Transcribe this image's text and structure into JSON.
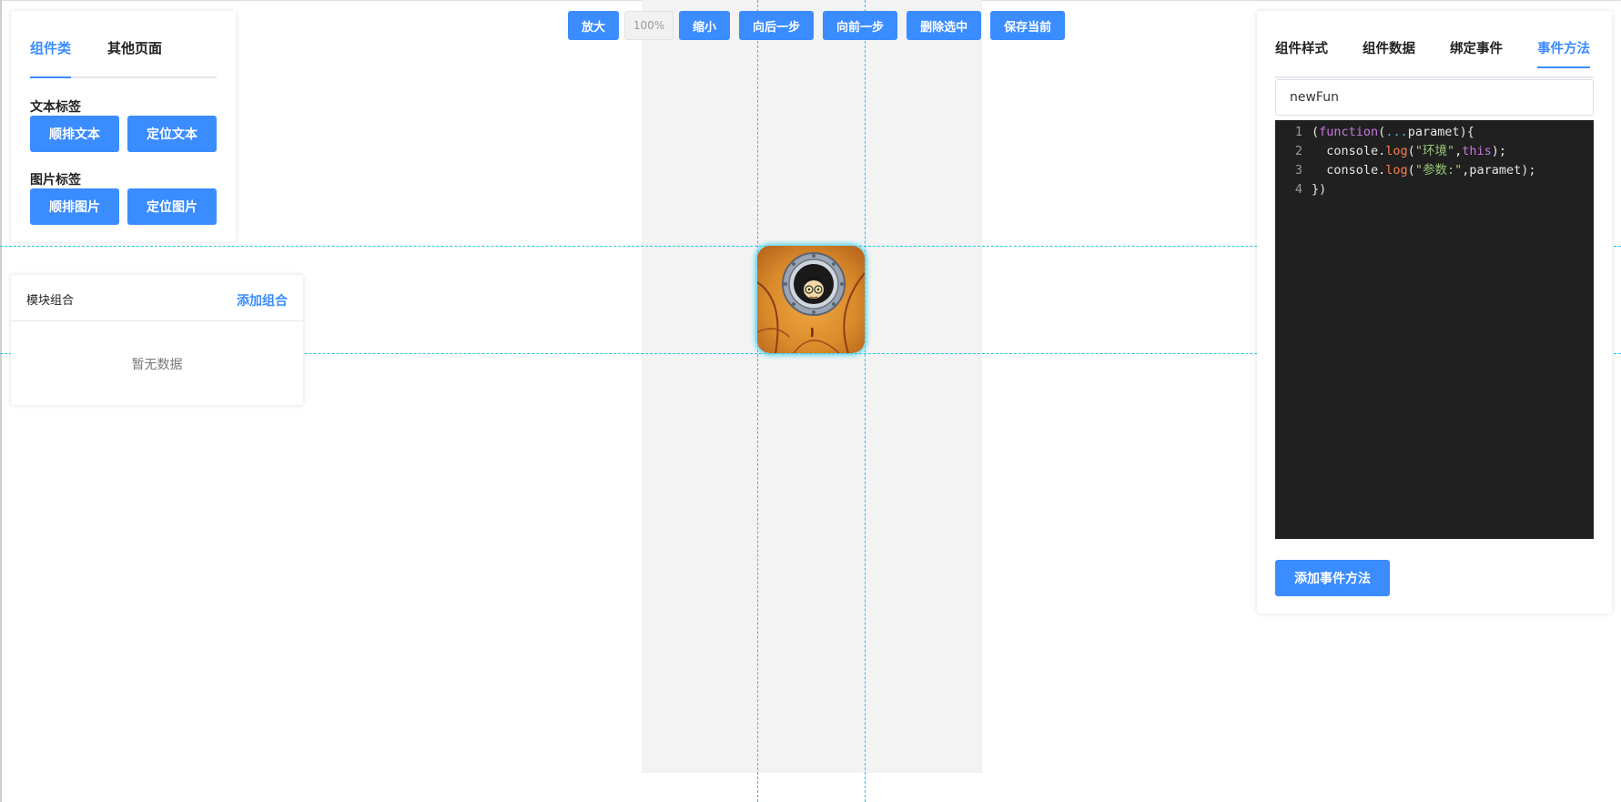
{
  "toolbar": {
    "zoom_in": "放大",
    "zoom_level": "100%",
    "zoom_out": "缩小",
    "undo": "向后一步",
    "redo": "向前一步",
    "delete_selected": "删除选中",
    "save_current": "保存当前"
  },
  "component_panel": {
    "tabs": [
      "组件类",
      "其他页面"
    ],
    "active_tab": "组件类",
    "text_section": {
      "title": "文本标签",
      "buttons": [
        "顺排文本",
        "定位文本"
      ]
    },
    "image_section": {
      "title": "图片标签",
      "buttons": [
        "顺排图片",
        "定位图片"
      ]
    }
  },
  "combo_panel": {
    "title": "模块组合",
    "add_label": "添加组合",
    "empty_text": "暂无数据"
  },
  "property_panel": {
    "tabs": [
      "组件样式",
      "组件数据",
      "绑定事件",
      "事件方法"
    ],
    "active_tab": "事件方法",
    "method_name": "newFun",
    "add_button": "添加事件方法",
    "code": {
      "line_numbers": [
        "1",
        "2",
        "3",
        "4"
      ],
      "l1": {
        "open": "(",
        "kw": "function",
        "paren": "(",
        "spread": "...",
        "rest": "paramet){"
      },
      "l2": {
        "obj": "  console.",
        "fn": "log",
        "p": "(",
        "str": "\"环境\"",
        "comma": ",",
        "kw": "this",
        "end": ");"
      },
      "l3": {
        "obj": "  console.",
        "fn": "log",
        "p": "(",
        "str": "\"参数:\"",
        "end": ",paramet);"
      },
      "l4": {
        "text": "})"
      }
    }
  },
  "canvas": {
    "selected_image": "cartoon-character-porthole-image"
  },
  "colors": {
    "primary": "#3b8cff",
    "guide": "#27c3e6",
    "editor_bg": "#202020",
    "canvas_bg": "#f3f3f3"
  }
}
